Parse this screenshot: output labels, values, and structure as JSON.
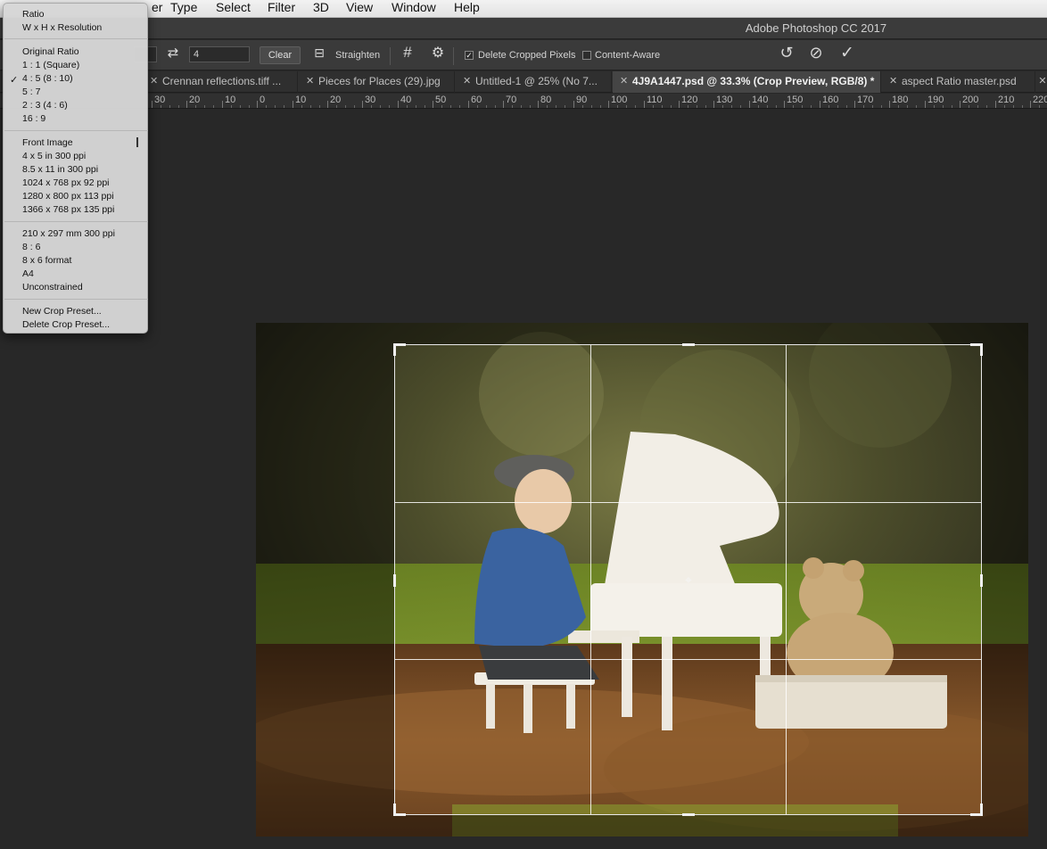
{
  "menubar": {
    "items": [
      "er",
      "Type",
      "Select",
      "Filter",
      "3D",
      "View",
      "Window",
      "Help"
    ]
  },
  "window": {
    "title": "Adobe Photoshop CC 2017"
  },
  "options": {
    "height_value": "4",
    "clear_label": "Clear",
    "straighten_label": "Straighten",
    "delete_cropped_label": "Delete Cropped Pixels",
    "delete_cropped_checked": true,
    "content_aware_label": "Content-Aware",
    "content_aware_checked": false
  },
  "tabs": [
    {
      "label": "Crennan reflections.tiff ...",
      "active": false
    },
    {
      "label": "Pieces for Places (29).jpg",
      "active": false
    },
    {
      "label": "Untitled-1 @ 25% (No 7...",
      "active": false
    },
    {
      "label": "4J9A1447.psd @ 33.3% (Crop Preview, RGB/8) *",
      "active": true
    },
    {
      "label": "aspect Ratio master.psd",
      "active": false
    }
  ],
  "ruler": {
    "labels": [
      "30",
      "20",
      "10",
      "0",
      "10",
      "20",
      "30",
      "40",
      "50",
      "60",
      "70",
      "80",
      "90",
      "100",
      "110",
      "120",
      "130",
      "140",
      "150",
      "160",
      "170",
      "180",
      "190",
      "200",
      "210",
      "220"
    ]
  },
  "preset_menu": {
    "group1": [
      "Ratio",
      "W x H x Resolution"
    ],
    "group2": [
      "Original Ratio",
      "1 : 1 (Square)",
      "4 : 5 (8 : 10)",
      "5 : 7",
      "2 : 3 (4 : 6)",
      "16 : 9"
    ],
    "checked_item": "4 : 5 (8 : 10)",
    "group3": [
      "Front Image",
      "4 x 5 in 300 ppi",
      "8.5 x 11 in 300 ppi",
      "1024 x 768 px 92 ppi",
      "1280 x 800 px 113 ppi",
      "1366 x 768 px 135 ppi"
    ],
    "group4": [
      "210 x 297 mm 300 ppi",
      "8 : 6",
      "8 x 6 format",
      "A4",
      "Unconstrained"
    ],
    "group5": [
      "New Crop Preset...",
      "Delete Crop Preset..."
    ]
  },
  "colors": {
    "panel_bg": "#3a3a3a",
    "canvas_bg": "#282828",
    "menu_bg": "#d6d6d6",
    "crop_guide": "#ffffff"
  }
}
